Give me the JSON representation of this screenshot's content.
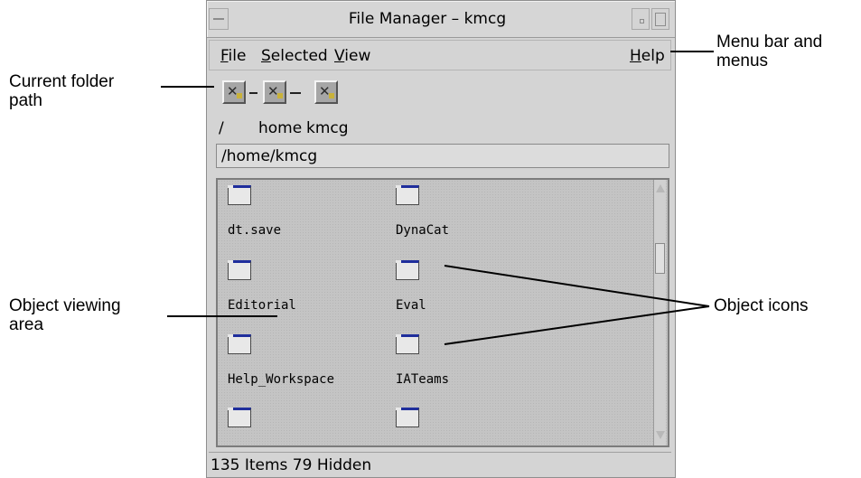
{
  "window": {
    "title": "File Manager – kmcg"
  },
  "menubar": {
    "file": "File",
    "selected": "Selected",
    "view": "View",
    "help": "Help"
  },
  "path": {
    "icon_names": [
      "folder-path-icon",
      "folder-path-icon",
      "folder-path-icon"
    ],
    "labels": [
      "/",
      "home",
      "kmcg"
    ],
    "current": "/home/kmcg"
  },
  "objects": [
    {
      "name": "dt.save",
      "icon": "folder-icon"
    },
    {
      "name": "DynaCat",
      "icon": "folder-icon"
    },
    {
      "name": "Editorial",
      "icon": "folder-icon"
    },
    {
      "name": "Eval",
      "icon": "folder-icon"
    },
    {
      "name": "Help_Workspace",
      "icon": "folder-icon"
    },
    {
      "name": "IATeams",
      "icon": "folder-icon"
    },
    {
      "name": "",
      "icon": "folder-icon"
    },
    {
      "name": "",
      "icon": "folder-icon"
    }
  ],
  "status": "135 Items 79 Hidden",
  "callouts": {
    "current_path": [
      "Current folder",
      "path"
    ],
    "menu_bar": [
      "Menu bar and",
      "menus"
    ],
    "viewing_area": [
      "Object viewing",
      "area"
    ],
    "object_icons": "Object icons"
  },
  "colors": {
    "window_bg": "#d4d4d4",
    "folder_tab": "#1f2e9c",
    "view_bg": "#c4c4c4"
  }
}
